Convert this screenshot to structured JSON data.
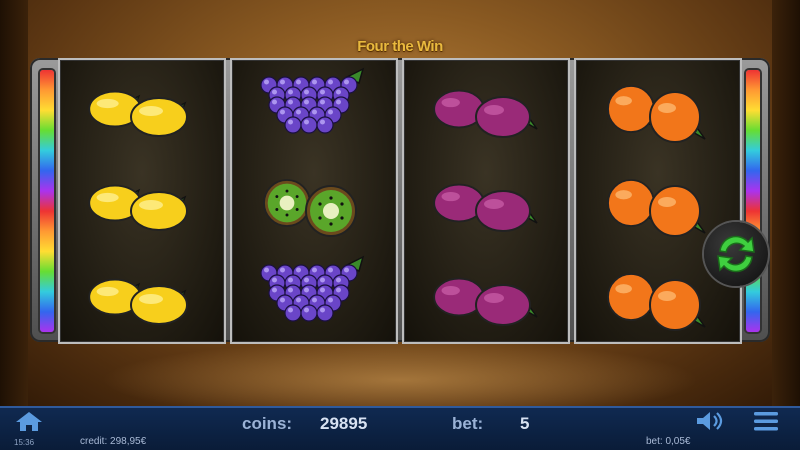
{
  "game": {
    "title": "Four the Win",
    "reels": [
      [
        "lemon",
        "lemon",
        "lemon"
      ],
      [
        "grapes",
        "kiwi",
        "grapes"
      ],
      [
        "plum",
        "plum",
        "plum"
      ],
      [
        "orange",
        "orange",
        "orange"
      ]
    ],
    "spin_icon": "spin-arrows-icon"
  },
  "status_bar": {
    "home_icon": "home-icon",
    "coins_label": "coins:",
    "coins_value": "29895",
    "bet_label": "bet:",
    "bet_value": "5",
    "sound_icon": "speaker-icon",
    "menu_icon": "hamburger-menu-icon",
    "time": "15:36",
    "credit": "credit: 298,95€",
    "bet_eur": "bet: 0,05€"
  },
  "colors": {
    "lemon": "#f7cf1c",
    "grapes": "#6a45c8",
    "kiwi": "#5aa62a",
    "plum": "#9a2a78",
    "orange": "#f2761a",
    "spin": "#3fcf3f",
    "status_bg": "#0a1c38"
  }
}
